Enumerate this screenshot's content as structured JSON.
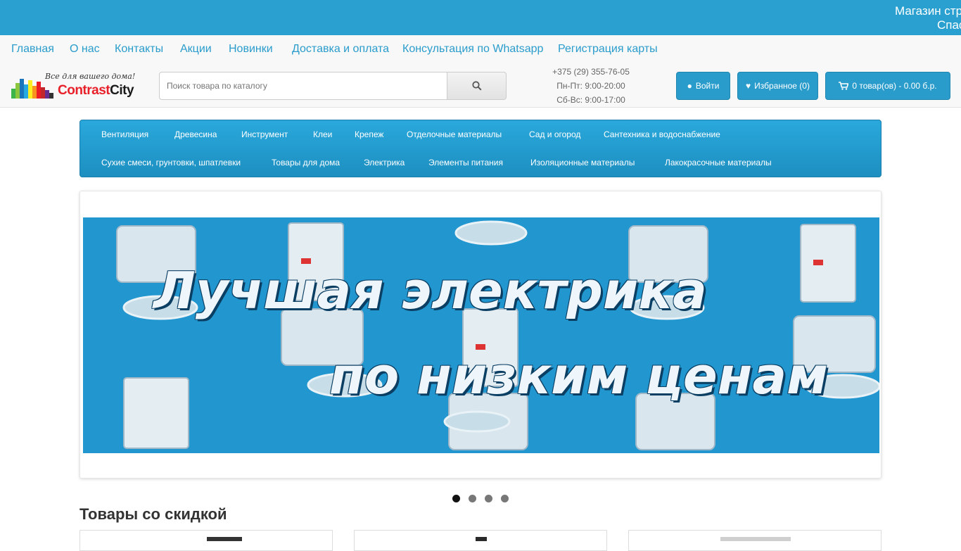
{
  "topbar": {
    "marquee_line1": "Магазин стр",
    "marquee_line2": "Спас"
  },
  "toplinks": [
    {
      "label": "Главная"
    },
    {
      "label": "О нас"
    },
    {
      "label": "Контакты"
    },
    {
      "label": "Акции"
    },
    {
      "label": "Новинки"
    },
    {
      "label": "Доставка и оплата"
    },
    {
      "label": "Консультация по Whatsapp"
    },
    {
      "label": "Регистрация карты"
    }
  ],
  "logo": {
    "slogan": "Все для вашего дома!",
    "brand_a": "Contrast",
    "brand_b": "City"
  },
  "search": {
    "placeholder": "Поиск товара по каталогу"
  },
  "contacts": {
    "phone": "+375 (29) 355-76-05",
    "hours_weekdays": "Пн-Пт: 9:00-20:00",
    "hours_weekend": "Сб-Вс: 9:00-17:00"
  },
  "header_buttons": {
    "login": "Войти",
    "favorites": "Избранное (0)",
    "cart": "0 товар(ов) - 0.00 б.р."
  },
  "categories": [
    {
      "label": "Вентиляция"
    },
    {
      "label": "Древесина"
    },
    {
      "label": "Инструмент"
    },
    {
      "label": "Клеи"
    },
    {
      "label": "Крепеж"
    },
    {
      "label": "Отделочные материалы"
    },
    {
      "label": "Сад и огород"
    },
    {
      "label": "Сантехника и водоснабжение"
    },
    {
      "label": "Сухие смеси, грунтовки, шпатлевки"
    },
    {
      "label": "Товары для дома"
    },
    {
      "label": "Электрика"
    },
    {
      "label": "Элементы питания"
    },
    {
      "label": "Изоляционные материалы"
    },
    {
      "label": "Лакокрасочные материалы"
    }
  ],
  "slider": {
    "banner_line1": "Лучшая электрика",
    "banner_line2": "по низким ценам",
    "slide_count": 4,
    "active_slide": 1
  },
  "discount_section": {
    "title": "Товары со скидкой"
  },
  "colors": {
    "brand_blue": "#2aa0d0",
    "link_blue": "#2a9ccc",
    "logo_red": "#e8202a"
  }
}
